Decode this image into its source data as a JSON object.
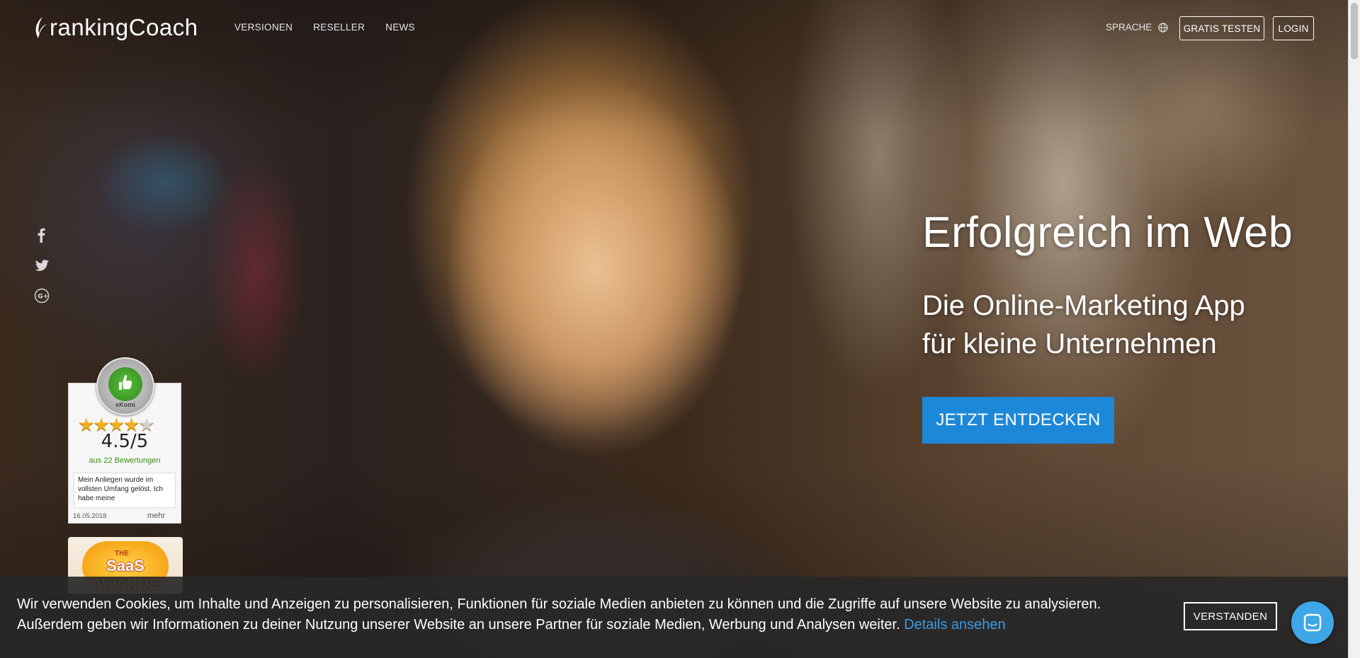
{
  "header": {
    "logo_text": "rankingCoach",
    "nav": [
      {
        "label": "VERSIONEN"
      },
      {
        "label": "RESELLER"
      },
      {
        "label": "NEWS"
      }
    ],
    "language_label": "SPRACHE",
    "trial_button": "GRATIS TESTEN",
    "login_button": "LOGIN"
  },
  "social": [
    "facebook-icon",
    "twitter-icon",
    "google-plus-icon"
  ],
  "hero": {
    "title": "Erfolgreich im Web",
    "subtitle_line1": "Die Online-Marketing App",
    "subtitle_line2": "für kleine Unternehmen",
    "cta": "JETZT ENTDECKEN"
  },
  "ekomi": {
    "badge_label": "eKomi",
    "badge_ring_text": "KUNDENAUSZEICHNUNG",
    "stars": 4.5,
    "score": "4.5/5",
    "count": "aus 22 Bewertungen",
    "review": "Mein Anliegen wurde im vollsten Umfang gelöst. Ich habe meine",
    "date": "16.05.2018",
    "more": "mehr"
  },
  "saas": {
    "the": "THE",
    "text": "SaaS AWARDS"
  },
  "cookie": {
    "text": "Wir verwenden Cookies, um Inhalte und Anzeigen zu personalisieren, Funktionen für soziale Medien anbieten zu können und die Zugriffe auf unsere Website zu analysieren. Außerdem geben wir Informationen zu deiner Nutzung unserer Website an unsere Partner für soziale Medien, Werbung und Analysen weiter.",
    "link": "Details ansehen",
    "button": "VERSTANDEN"
  },
  "colors": {
    "cta": "#1e88d8",
    "link": "#3a9be6",
    "chat": "#3fa7e8",
    "star": "#f2b01e"
  }
}
